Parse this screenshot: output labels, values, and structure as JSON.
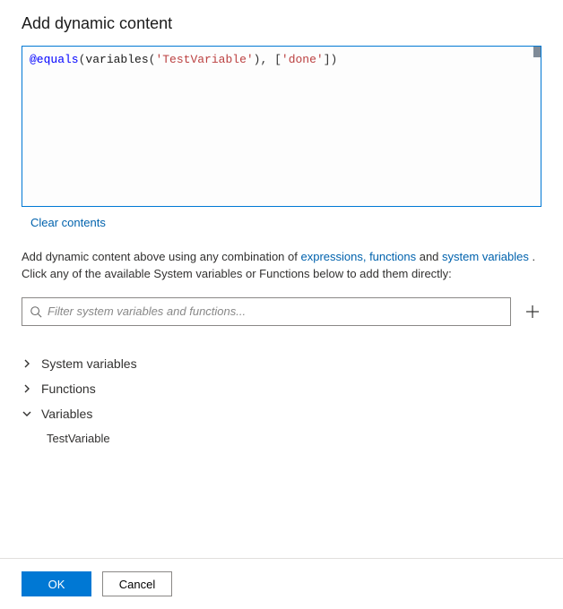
{
  "title": "Add dynamic content",
  "expression": {
    "tokens": [
      {
        "cls": "tok-keyword",
        "text": "@equals"
      },
      {
        "cls": "tok-punct",
        "text": "("
      },
      {
        "cls": "tok-func",
        "text": "variables"
      },
      {
        "cls": "tok-punct",
        "text": "("
      },
      {
        "cls": "tok-string",
        "text": "'TestVariable'"
      },
      {
        "cls": "tok-punct",
        "text": "), ["
      },
      {
        "cls": "tok-arrstr",
        "text": "'done'"
      },
      {
        "cls": "tok-punct",
        "text": "])"
      }
    ],
    "raw": "@equals(variables('TestVariable'), ['done'])"
  },
  "clear_label": "Clear contents",
  "help": {
    "pre": "Add dynamic content above using any combination of ",
    "link1": "expressions, functions",
    "mid": " and ",
    "link2": "system variables",
    "post": " . Click any of the available System variables or Functions below to add them directly:"
  },
  "filter": {
    "placeholder": "Filter system variables and functions..."
  },
  "tree": {
    "groups": [
      {
        "label": "System variables",
        "expanded": false
      },
      {
        "label": "Functions",
        "expanded": false
      },
      {
        "label": "Variables",
        "expanded": true,
        "children": [
          "TestVariable"
        ]
      }
    ]
  },
  "footer": {
    "ok": "OK",
    "cancel": "Cancel"
  }
}
